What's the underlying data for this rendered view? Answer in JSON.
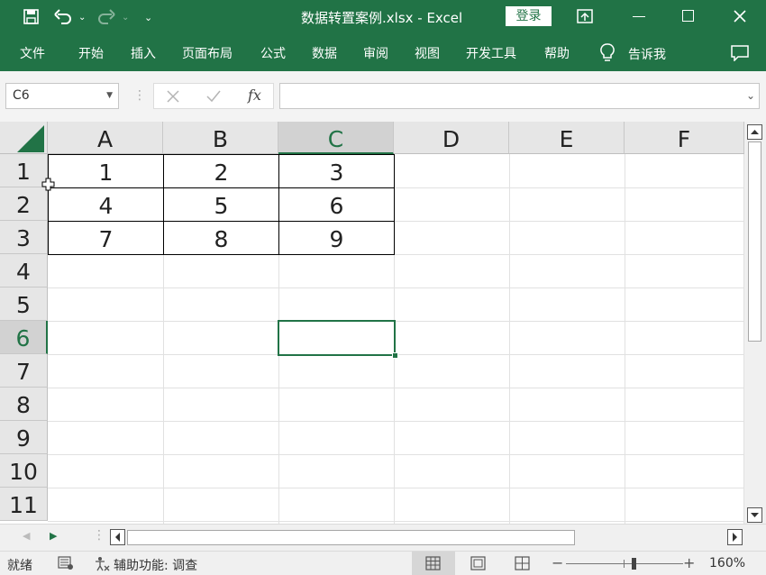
{
  "window": {
    "title": "数据转置案例.xlsx  -  Excel",
    "login_label": "登录"
  },
  "ribbon": {
    "tabs": [
      "文件",
      "开始",
      "插入",
      "页面布局",
      "公式",
      "数据",
      "审阅",
      "视图",
      "开发工具",
      "帮助"
    ],
    "tell_me": "告诉我"
  },
  "formula_bar": {
    "name_box": "C6",
    "formula": ""
  },
  "sheet": {
    "columns": [
      "A",
      "B",
      "C",
      "D",
      "E",
      "F"
    ],
    "rows": [
      "1",
      "2",
      "3",
      "4",
      "5",
      "6",
      "7",
      "8",
      "9",
      "10",
      "11"
    ],
    "selected_column": "C",
    "selected_row": "6",
    "cells": [
      [
        "1",
        "2",
        "3"
      ],
      [
        "4",
        "5",
        "6"
      ],
      [
        "7",
        "8",
        "9"
      ]
    ]
  },
  "status": {
    "ready": "就绪",
    "accessibility": "辅助功能: 调查",
    "zoom": "160%"
  },
  "colors": {
    "accent": "#217346"
  }
}
